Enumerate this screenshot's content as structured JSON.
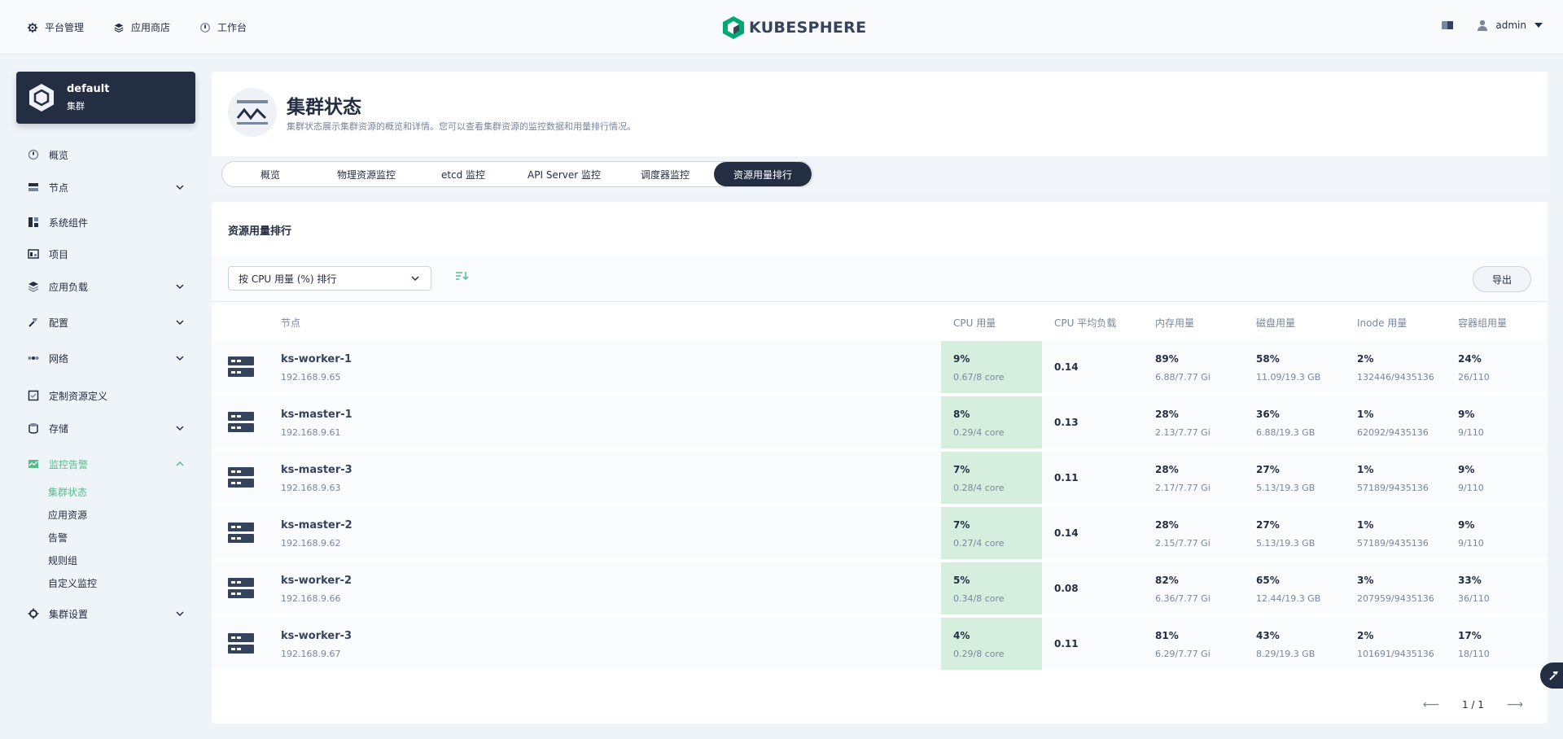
{
  "header": {
    "nav": [
      {
        "label": "平台管理",
        "icon": "platform-gear-icon"
      },
      {
        "label": "应用商店",
        "icon": "app-store-icon"
      },
      {
        "label": "工作台",
        "icon": "workbench-icon"
      }
    ],
    "brand": "KUBESPHERE",
    "user": "admin"
  },
  "cluster": {
    "name": "default",
    "type": "集群"
  },
  "sidebar": {
    "items": [
      {
        "label": "概览"
      },
      {
        "label": "节点"
      },
      {
        "label": "系统组件"
      },
      {
        "label": "项目"
      },
      {
        "label": "应用负载"
      },
      {
        "label": "配置"
      },
      {
        "label": "网络"
      },
      {
        "label": "定制资源定义"
      },
      {
        "label": "存储"
      },
      {
        "label": "监控告警"
      },
      {
        "label": "集群设置"
      }
    ],
    "monitor_sub": [
      "集群状态",
      "应用资源",
      "告警",
      "规则组",
      "自定义监控"
    ]
  },
  "page": {
    "title": "集群状态",
    "description": "集群状态展示集群资源的概览和详情。您可以查看集群资源的监控数据和用量排行情况。",
    "tabs": [
      "概览",
      "物理资源监控",
      "etcd 监控",
      "API Server 监控",
      "调度器监控",
      "资源用量排行"
    ]
  },
  "ranking": {
    "title": "资源用量排行",
    "sort_by": "按 CPU 用量 (%) 排行",
    "export": "导出",
    "columns": [
      "节点",
      "CPU 用量",
      "CPU 平均负载",
      "内存用量",
      "磁盘用量",
      "Inode 用量",
      "容器组用量"
    ],
    "rows": [
      {
        "name": "ks-worker-1",
        "ip": "192.168.9.65",
        "cpu": "9%",
        "cpu_detail": "0.67/8 core",
        "load": "0.14",
        "mem": "89%",
        "mem_detail": "6.88/7.77 Gi",
        "disk": "58%",
        "disk_detail": "11.09/19.3 GB",
        "inode": "2%",
        "inode_detail": "132446/9435136",
        "pod": "24%",
        "pod_detail": "26/110"
      },
      {
        "name": "ks-master-1",
        "ip": "192.168.9.61",
        "cpu": "8%",
        "cpu_detail": "0.29/4 core",
        "load": "0.13",
        "mem": "28%",
        "mem_detail": "2.13/7.77 Gi",
        "disk": "36%",
        "disk_detail": "6.88/19.3 GB",
        "inode": "1%",
        "inode_detail": "62092/9435136",
        "pod": "9%",
        "pod_detail": "9/110"
      },
      {
        "name": "ks-master-3",
        "ip": "192.168.9.63",
        "cpu": "7%",
        "cpu_detail": "0.28/4 core",
        "load": "0.11",
        "mem": "28%",
        "mem_detail": "2.17/7.77 Gi",
        "disk": "27%",
        "disk_detail": "5.13/19.3 GB",
        "inode": "1%",
        "inode_detail": "57189/9435136",
        "pod": "9%",
        "pod_detail": "9/110"
      },
      {
        "name": "ks-master-2",
        "ip": "192.168.9.62",
        "cpu": "7%",
        "cpu_detail": "0.27/4 core",
        "load": "0.14",
        "mem": "28%",
        "mem_detail": "2.15/7.77 Gi",
        "disk": "27%",
        "disk_detail": "5.13/19.3 GB",
        "inode": "1%",
        "inode_detail": "57189/9435136",
        "pod": "9%",
        "pod_detail": "9/110"
      },
      {
        "name": "ks-worker-2",
        "ip": "192.168.9.66",
        "cpu": "5%",
        "cpu_detail": "0.34/8 core",
        "load": "0.08",
        "mem": "82%",
        "mem_detail": "6.36/7.77 Gi",
        "disk": "65%",
        "disk_detail": "12.44/19.3 GB",
        "inode": "3%",
        "inode_detail": "207959/9435136",
        "pod": "33%",
        "pod_detail": "36/110"
      },
      {
        "name": "ks-worker-3",
        "ip": "192.168.9.67",
        "cpu": "4%",
        "cpu_detail": "0.29/8 core",
        "load": "0.11",
        "mem": "81%",
        "mem_detail": "6.29/7.77 Gi",
        "disk": "43%",
        "disk_detail": "8.29/19.3 GB",
        "inode": "2%",
        "inode_detail": "101691/9435136",
        "pod": "17%",
        "pod_detail": "18/110"
      }
    ],
    "pagination": "1 / 1"
  },
  "colors": {
    "accent": "#55bc8a",
    "dark": "#242e42",
    "cpu_highlight": "#d6eede"
  }
}
